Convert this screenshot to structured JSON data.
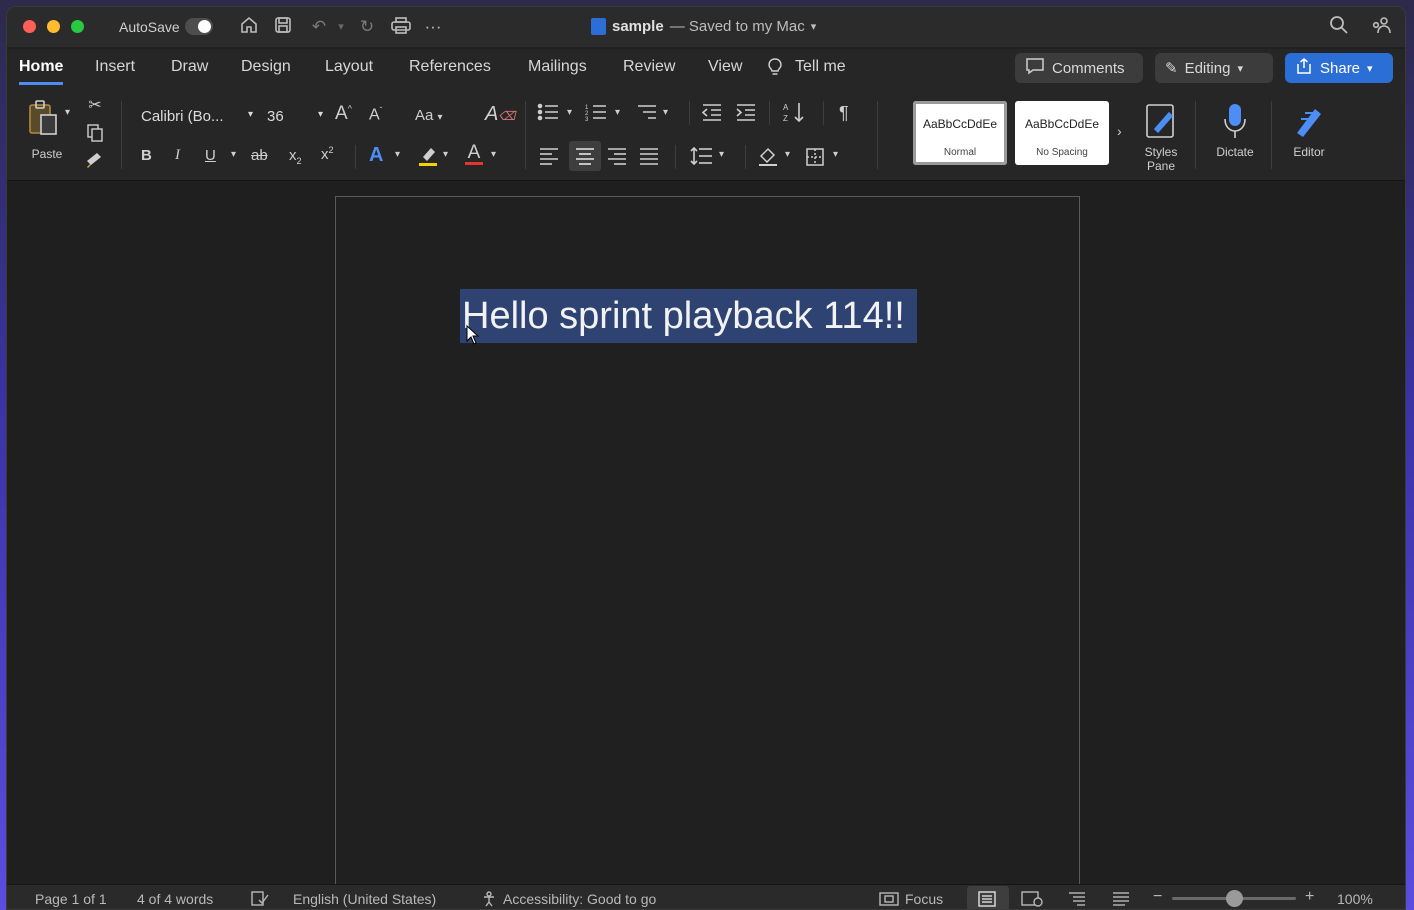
{
  "titlebar": {
    "autosave_label": "AutoSave",
    "doc_name": "sample",
    "doc_status": "— Saved to my Mac",
    "more_glyph": "···"
  },
  "tabs": [
    {
      "label": "Home",
      "active": true
    },
    {
      "label": "Insert"
    },
    {
      "label": "Draw"
    },
    {
      "label": "Design"
    },
    {
      "label": "Layout"
    },
    {
      "label": "References"
    },
    {
      "label": "Mailings"
    },
    {
      "label": "Review"
    },
    {
      "label": "View"
    },
    {
      "label": "Tell me"
    }
  ],
  "actions": {
    "comments": "Comments",
    "editing": "Editing",
    "share": "Share"
  },
  "ribbon": {
    "paste_label": "Paste",
    "font_name": "Calibri (Bo...",
    "font_size": "36",
    "change_case": "Aa",
    "styles": [
      {
        "sample": "AaBbCcDdEe",
        "name": "Normal",
        "selected": true
      },
      {
        "sample": "AaBbCcDdEe",
        "name": "No Spacing"
      }
    ],
    "styles_pane": "Styles Pane",
    "dictate": "Dictate",
    "editor": "Editor"
  },
  "document": {
    "text": "Hello sprint playback 114!!",
    "selection_color": "#2f4373"
  },
  "status": {
    "page": "Page 1 of 1",
    "words": "4 of 4 words",
    "language": "English (United States)",
    "accessibility": "Accessibility: Good to go",
    "focus": "Focus",
    "zoom": "100%"
  },
  "colors": {
    "accent": "#4c8df6",
    "share": "#2b6fd6",
    "highlight_marker": "#f5d300",
    "font_color_marker": "#e8352c"
  }
}
